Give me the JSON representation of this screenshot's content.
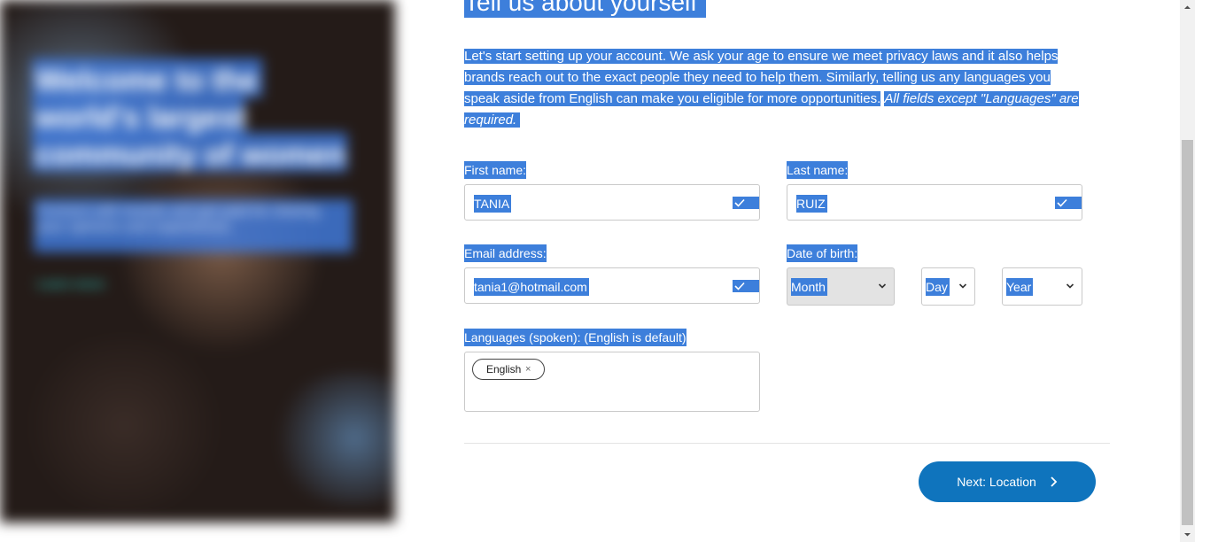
{
  "hero": {
    "headline": "Welcome to the world's largest community of women",
    "subtext": "Connect with brands and get paid for sharing your opinions and experiences.",
    "link": "Learn more"
  },
  "form": {
    "title": "Tell us about yourself",
    "intro": "Let's start setting up your account. We ask your age to ensure we meet privacy laws and it also helps brands reach out to the exact people they need to help them. Similarly, telling us any languages you speak aside from English can make you eligible for more opportunities.",
    "intro_note": "All fields except \"Languages\" are required.",
    "first_name": {
      "label": "First name:",
      "value": "TANIA"
    },
    "last_name": {
      "label": "Last name:",
      "value": "RUIZ"
    },
    "email": {
      "label": "Email address:",
      "value": "tania1@hotmail.com"
    },
    "dob": {
      "label": "Date of birth:",
      "month": "Month",
      "day": "Day",
      "year": "Year"
    },
    "languages": {
      "label": "Languages (spoken): (English is default)",
      "chips": [
        {
          "label": "English",
          "remove": "×"
        }
      ]
    },
    "next_button": "Next: Location"
  },
  "colors": {
    "selection": "#3d7fdb",
    "primary_button": "#0f74bd"
  }
}
